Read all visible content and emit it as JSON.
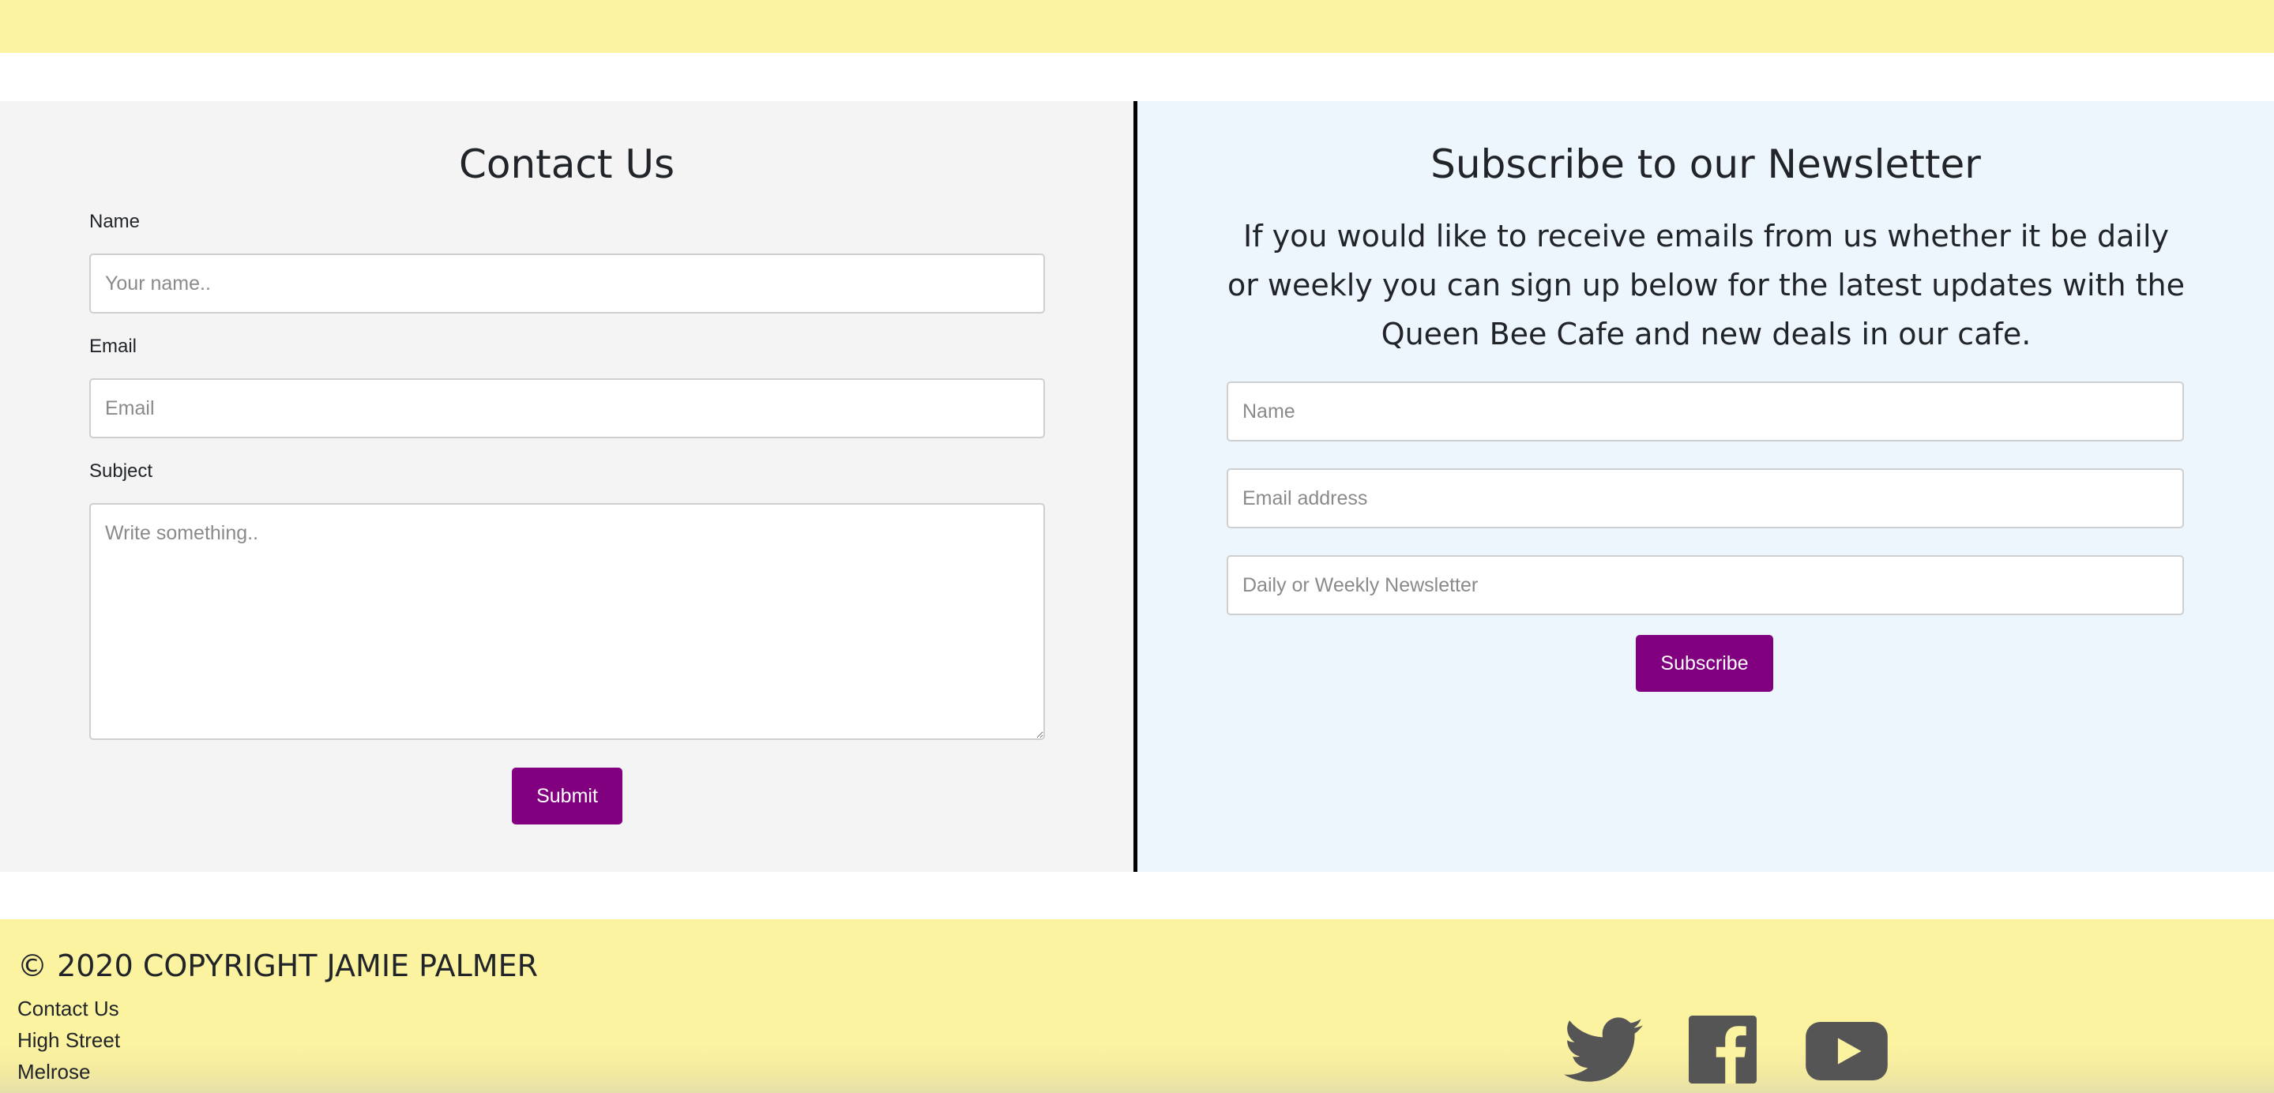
{
  "contact": {
    "title": "Contact Us",
    "name_label": "Name",
    "name_placeholder": "Your name..",
    "email_label": "Email",
    "email_placeholder": "Email",
    "subject_label": "Subject",
    "subject_placeholder": "Write something..",
    "submit_label": "Submit"
  },
  "newsletter": {
    "title": "Subscribe to our Newsletter",
    "intro": "If you would like to receive emails from us whether it be daily or weekly you can sign up below for the latest updates with the Queen Bee Cafe and new deals in our cafe.",
    "name_placeholder": "Name",
    "email_placeholder": "Email address",
    "frequency_placeholder": "Daily or Weekly Newsletter",
    "subscribe_label": "Subscribe"
  },
  "footer": {
    "copyright": "© 2020 COPYRIGHT JAMIE PALMER",
    "lines": [
      "Contact Us",
      "High Street",
      "Melrose"
    ],
    "social_icons": [
      "twitter-icon",
      "facebook-icon",
      "youtube-icon"
    ]
  },
  "colors": {
    "band": "#fcf3a1",
    "contact_bg": "#f4f4f4",
    "newsletter_bg": "#eef6fd",
    "button": "#800080",
    "social_icon": "#555555"
  }
}
